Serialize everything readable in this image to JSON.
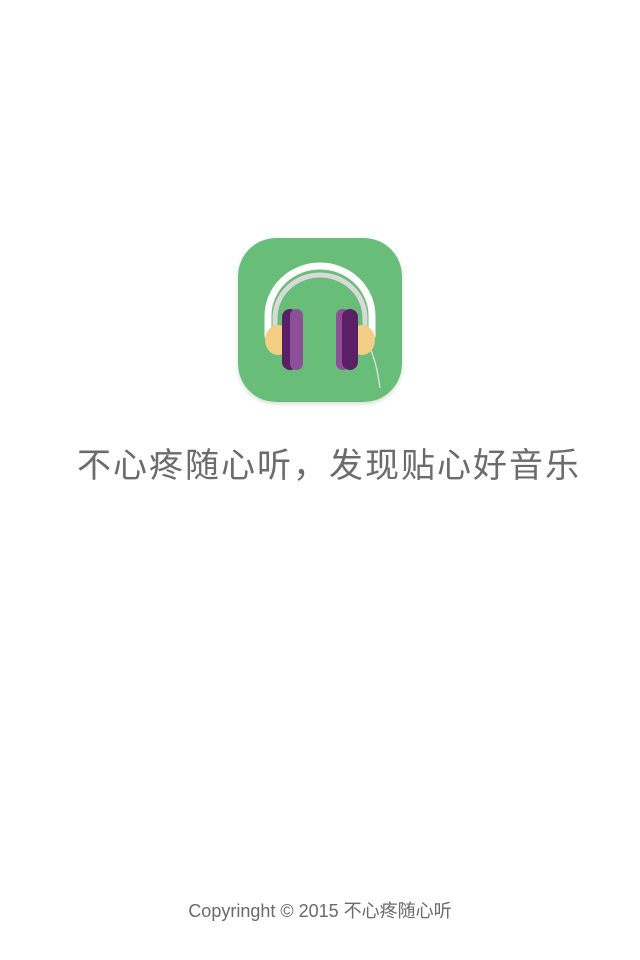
{
  "splash": {
    "slogan": "不心疼随心听，发现贴心好音乐",
    "copyright": "Copyringht © 2015 不心疼随心听"
  },
  "logo": {
    "icon": "headphones-icon",
    "background_color": "#68bd78",
    "band_color": "#ffffff",
    "inner_band_color": "#d9d9d9",
    "cup_outer_color": "#f3cf86",
    "cup_purple_color": "#8e4f99",
    "cup_dark_color": "#5a1f64"
  }
}
